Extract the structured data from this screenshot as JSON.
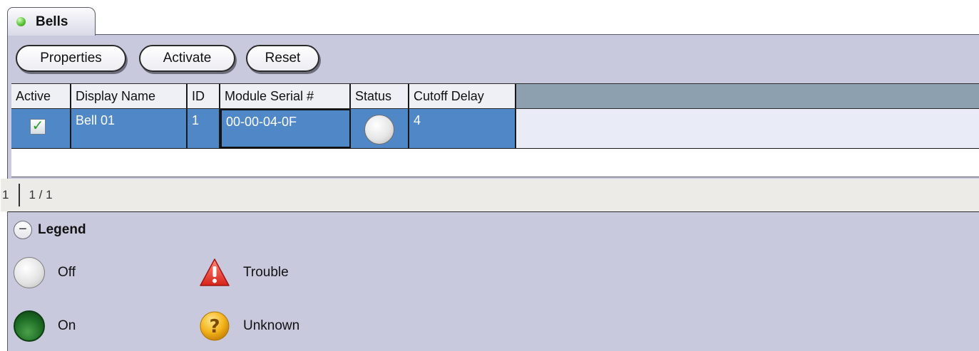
{
  "tab": {
    "label": "Bells",
    "status_color": "#5cc43a"
  },
  "toolbar": {
    "properties_label": "Properties",
    "activate_label": "Activate",
    "reset_label": "Reset"
  },
  "grid": {
    "columns": [
      "Active",
      "Display Name",
      "ID",
      "Module Serial #",
      "Status",
      "Cutoff Delay"
    ],
    "rows": [
      {
        "active": true,
        "display_name": "Bell  01",
        "id": "1",
        "module_serial": "00-00-04-0F",
        "status": "off",
        "cutoff_delay": "4"
      }
    ],
    "selection_color": "#4f87c7"
  },
  "pager": {
    "page": "1",
    "of": "1 / 1"
  },
  "legend": {
    "title": "Legend",
    "items": [
      {
        "label": "Off",
        "icon": "status-off-icon"
      },
      {
        "label": "Trouble",
        "icon": "trouble-warning-icon"
      },
      {
        "label": "On",
        "icon": "status-on-icon"
      },
      {
        "label": "Unknown",
        "icon": "unknown-question-icon"
      }
    ]
  }
}
